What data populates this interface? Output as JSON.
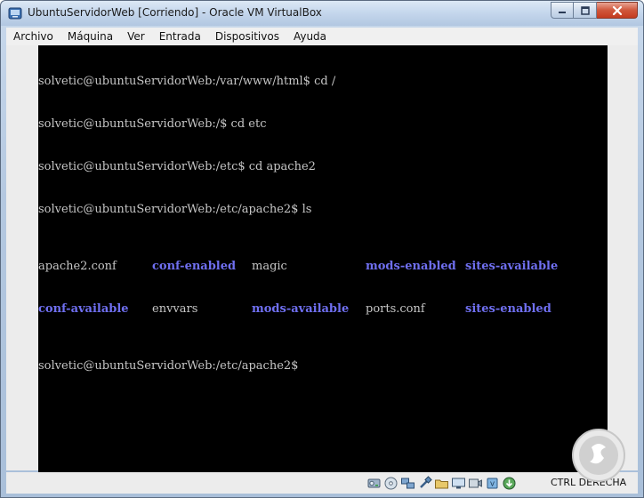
{
  "window": {
    "title": "UbuntuServidorWeb [Corriendo] - Oracle VM VirtualBox"
  },
  "menubar": {
    "items": [
      {
        "label": "Archivo"
      },
      {
        "label": "Máquina"
      },
      {
        "label": "Ver"
      },
      {
        "label": "Entrada"
      },
      {
        "label": "Dispositivos"
      },
      {
        "label": "Ayuda"
      }
    ]
  },
  "terminal": {
    "lines": [
      "solvetic@ubuntuServidorWeb:/var/www/html$ cd /",
      "solvetic@ubuntuServidorWeb:/$ cd etc",
      "solvetic@ubuntuServidorWeb:/etc$ cd apache2",
      "solvetic@ubuntuServidorWeb:/etc/apache2$ ls"
    ],
    "ls_rows": [
      [
        {
          "name": "apache2.conf",
          "kind": "file"
        },
        {
          "name": "conf-enabled",
          "kind": "dir"
        },
        {
          "name": "magic",
          "kind": "file"
        },
        {
          "name": "mods-enabled",
          "kind": "dir"
        },
        {
          "name": "sites-available",
          "kind": "dir"
        }
      ],
      [
        {
          "name": "conf-available",
          "kind": "dir"
        },
        {
          "name": "envvars",
          "kind": "file"
        },
        {
          "name": "mods-available",
          "kind": "dir"
        },
        {
          "name": "ports.conf",
          "kind": "file"
        },
        {
          "name": "sites-enabled",
          "kind": "dir"
        }
      ]
    ],
    "final_prompt": "solvetic@ubuntuServidorWeb:/etc/apache2$",
    "colors": {
      "text": "#c6c6c6",
      "dir": "#6f6ff0",
      "background": "#000000"
    }
  },
  "statusbar": {
    "icons": [
      "hard-disk-icon",
      "optical-drive-icon",
      "network-icon",
      "usb-icon",
      "shared-folders-icon",
      "display-icon",
      "video-capture-icon",
      "cpu-icon",
      "mouse-integration-icon"
    ],
    "host_key": "CTRL DERECHA"
  }
}
